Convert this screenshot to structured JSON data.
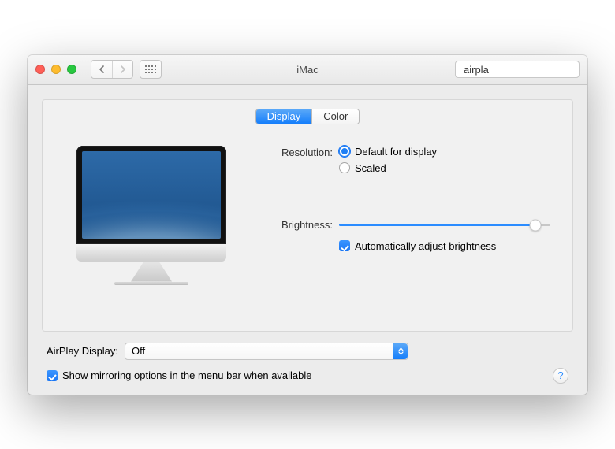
{
  "window": {
    "title": "iMac"
  },
  "search": {
    "value": "airpla"
  },
  "tabs": {
    "display": "Display",
    "color": "Color"
  },
  "resolution": {
    "label": "Resolution:",
    "default_label": "Default for display",
    "scaled_label": "Scaled"
  },
  "brightness": {
    "label": "Brightness:",
    "auto_label": "Automatically adjust brightness"
  },
  "airplay": {
    "label": "AirPlay Display:",
    "value": "Off"
  },
  "mirroring": {
    "label": "Show mirroring options in the menu bar when available"
  }
}
